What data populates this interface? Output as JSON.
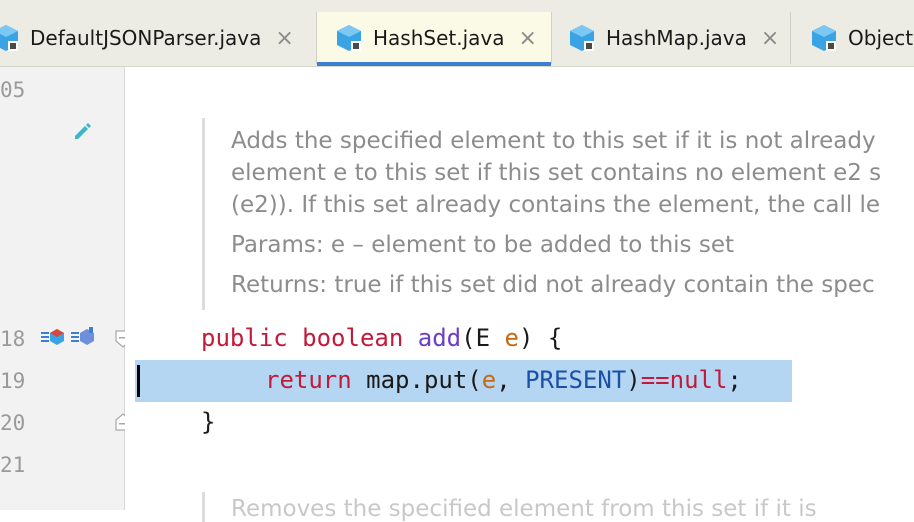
{
  "tabs": [
    {
      "label": "DefaultJSONParser.java",
      "close": "×",
      "active": false,
      "icon": "java-class-icon"
    },
    {
      "label": "HashSet.java",
      "close": "×",
      "active": true,
      "icon": "java-class-icon"
    },
    {
      "label": "HashMap.java",
      "close": "×",
      "active": false,
      "icon": "java-class-icon"
    },
    {
      "label": "Object",
      "close": "",
      "active": false,
      "icon": "java-class-icon"
    }
  ],
  "gutter": {
    "line_numbers": [
      "05",
      "18",
      "19",
      "20",
      "21"
    ]
  },
  "doc": {
    "line1": "Adds the specified element to this set if it is not already",
    "line2": "element e to this set if this set contains no element e2 s",
    "line3": "(e2)). If this set already contains the element, the call le",
    "params": "Params:  e – element to be added to this set",
    "returns": "Returns: true if this set did not already contain the spec",
    "next_partial": "Removes the specified element from this set if it is"
  },
  "code": {
    "line18": {
      "kw1": "public",
      "kw2": "boolean",
      "fn": "add",
      "open": "(",
      "type": "E",
      "param": "e",
      "rest": ") {"
    },
    "line19": {
      "kw": "return",
      "text1": " map.put(",
      "param": "e",
      "text2": ", ",
      "const": "PRESENT",
      "text3": ")",
      "op": "==",
      "kw2": "null",
      "end": ";"
    },
    "line20": {
      "text": "}"
    }
  },
  "colors": {
    "keyword": "#c41a3a",
    "method": "#6a3fc5",
    "param": "#c56a14",
    "constant": "#1b50a8",
    "selection": "#b4d6f2",
    "active_tab_underline": "#3f7fd1"
  }
}
